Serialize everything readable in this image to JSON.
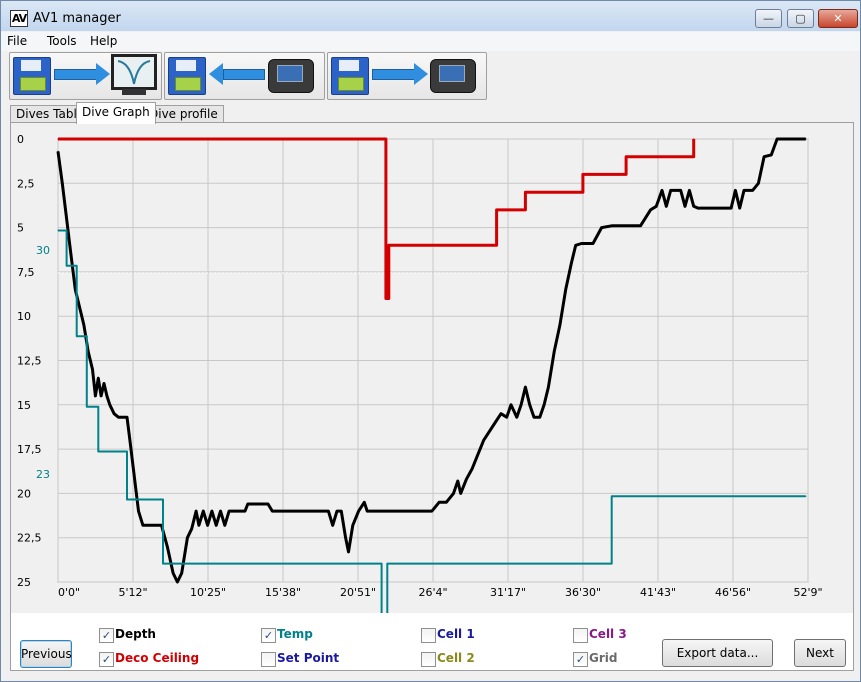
{
  "window": {
    "title": "AV1 manager",
    "icon_text": "AV",
    "minimize_icon": "minimize-icon",
    "maximize_icon": "maximize-icon",
    "close_icon": "close-icon"
  },
  "menu": {
    "items": [
      "File",
      "Tools",
      "Help"
    ]
  },
  "toolbar": {
    "buttons": [
      {
        "name": "save-to-monitor",
        "icons": [
          "floppy-disk-icon",
          "arrow-right-icon",
          "monitor-graph-icon"
        ]
      },
      {
        "name": "download-from-device",
        "icons": [
          "floppy-disk-icon",
          "arrow-left-icon",
          "dive-computer-icon"
        ]
      },
      {
        "name": "upload-to-device",
        "icons": [
          "floppy-disk-icon",
          "arrow-right-icon",
          "dive-computer-icon"
        ]
      }
    ]
  },
  "tabs": [
    {
      "label": "Dives Table",
      "active": false
    },
    {
      "label": "Dive Graph",
      "active": true
    },
    {
      "label": "Dive profile",
      "active": false
    }
  ],
  "chart_data": {
    "type": "line",
    "y_axis": {
      "reversed": true,
      "ylim": [
        0,
        25
      ],
      "tick_labels": [
        "0",
        "2,5",
        "5",
        "7,5",
        "10",
        "12,5",
        "15",
        "17,5",
        "20",
        "22,5",
        "25"
      ]
    },
    "x_axis": {
      "tick_labels": [
        "0'0\"",
        "5'12\"",
        "10'25\"",
        "15'38\"",
        "20'51\"",
        "26'4\"",
        "31'17\"",
        "36'30\"",
        "41'43\"",
        "46'56\"",
        "52'9\""
      ],
      "xlim_minutes": [
        0,
        52.15
      ]
    },
    "temp_axis": {
      "tick_labels": [
        "30",
        "23"
      ],
      "values": [
        30,
        23
      ]
    },
    "grid": true,
    "series": [
      {
        "name": "Depth",
        "color": "#000000",
        "axis": "depth_m",
        "points": [
          [
            0,
            0.7
          ],
          [
            0.3,
            2.5
          ],
          [
            0.6,
            4.5
          ],
          [
            0.9,
            6.5
          ],
          [
            1.2,
            8.5
          ],
          [
            1.5,
            9.5
          ],
          [
            1.8,
            10.5
          ],
          [
            2.1,
            12
          ],
          [
            2.4,
            13
          ],
          [
            2.6,
            14.5
          ],
          [
            2.8,
            13.5
          ],
          [
            3,
            14.5
          ],
          [
            3.2,
            13.8
          ],
          [
            3.4,
            14.5
          ],
          [
            3.6,
            15
          ],
          [
            3.9,
            15.5
          ],
          [
            4.2,
            15.7
          ],
          [
            4.8,
            15.7
          ],
          [
            5,
            17
          ],
          [
            5.3,
            19
          ],
          [
            5.6,
            21
          ],
          [
            5.9,
            21.8
          ],
          [
            6.5,
            21.8
          ],
          [
            7.2,
            21.8
          ],
          [
            7.6,
            23
          ],
          [
            8,
            24.5
          ],
          [
            8.3,
            25
          ],
          [
            8.6,
            24.5
          ],
          [
            9,
            22.5
          ],
          [
            9.3,
            22
          ],
          [
            9.6,
            21
          ],
          [
            9.8,
            21.8
          ],
          [
            10.1,
            21
          ],
          [
            10.4,
            21.8
          ],
          [
            10.7,
            21
          ],
          [
            11,
            21.8
          ],
          [
            11.3,
            21
          ],
          [
            11.6,
            21.8
          ],
          [
            11.9,
            21
          ],
          [
            12.3,
            21
          ],
          [
            13,
            21
          ],
          [
            13.2,
            20.6
          ],
          [
            14.6,
            20.6
          ],
          [
            14.9,
            21
          ],
          [
            16,
            21
          ],
          [
            17.5,
            21
          ],
          [
            18.8,
            21
          ],
          [
            19.1,
            21.8
          ],
          [
            19.4,
            21
          ],
          [
            19.7,
            21
          ],
          [
            20,
            22.5
          ],
          [
            20.2,
            23.3
          ],
          [
            20.5,
            21.8
          ],
          [
            20.9,
            21
          ],
          [
            21.3,
            20.5
          ],
          [
            21.5,
            21
          ],
          [
            22.5,
            21
          ],
          [
            24,
            21
          ],
          [
            26,
            21
          ],
          [
            26.5,
            20.5
          ],
          [
            27,
            20.5
          ],
          [
            27.5,
            20
          ],
          [
            27.8,
            19.3
          ],
          [
            28,
            20
          ],
          [
            28.4,
            19.2
          ],
          [
            28.8,
            18.6
          ],
          [
            29.2,
            17.8
          ],
          [
            29.6,
            17
          ],
          [
            30,
            16.5
          ],
          [
            30.4,
            16
          ],
          [
            30.8,
            15.5
          ],
          [
            31.2,
            15.7
          ],
          [
            31.5,
            15
          ],
          [
            31.9,
            15.7
          ],
          [
            32.2,
            15
          ],
          [
            32.5,
            14
          ],
          [
            32.8,
            15
          ],
          [
            33.1,
            15.7
          ],
          [
            33.5,
            15.7
          ],
          [
            33.8,
            15
          ],
          [
            34.1,
            14
          ],
          [
            34.5,
            12
          ],
          [
            34.9,
            10.5
          ],
          [
            35.3,
            8.5
          ],
          [
            35.7,
            7
          ],
          [
            36,
            6
          ],
          [
            36.4,
            5.9
          ],
          [
            37.2,
            5.9
          ],
          [
            37.8,
            5
          ],
          [
            38.5,
            4.9
          ],
          [
            40.5,
            4.9
          ],
          [
            41.2,
            4
          ],
          [
            41.6,
            3.8
          ],
          [
            42,
            2.9
          ],
          [
            42.3,
            3.8
          ],
          [
            42.6,
            2.9
          ],
          [
            43.3,
            2.9
          ],
          [
            43.6,
            3.8
          ],
          [
            43.9,
            2.9
          ],
          [
            44.2,
            3.8
          ],
          [
            44.5,
            3.9
          ],
          [
            46.8,
            3.9
          ],
          [
            47.1,
            2.9
          ],
          [
            47.4,
            3.9
          ],
          [
            47.7,
            2.9
          ],
          [
            48.3,
            2.9
          ],
          [
            48.7,
            2.5
          ],
          [
            49.1,
            1
          ],
          [
            49.6,
            0.9
          ],
          [
            50,
            0
          ],
          [
            52,
            0
          ]
        ]
      },
      {
        "name": "Deco Ceiling",
        "color": "#d20000",
        "axis": "depth_m",
        "points": [
          [
            0,
            0
          ],
          [
            22.8,
            0
          ],
          [
            22.8,
            9
          ],
          [
            23.0,
            9
          ],
          [
            23.0,
            6
          ],
          [
            30.5,
            6
          ],
          [
            30.5,
            4
          ],
          [
            32.5,
            4
          ],
          [
            32.5,
            3
          ],
          [
            36.5,
            3
          ],
          [
            36.5,
            2
          ],
          [
            39.5,
            2
          ],
          [
            39.5,
            1
          ],
          [
            44.2,
            1
          ],
          [
            44.2,
            0
          ]
        ]
      },
      {
        "name": "Temp",
        "color": "#00828a",
        "axis": "temp_c",
        "points": [
          [
            0,
            30.6
          ],
          [
            0.6,
            30.6
          ],
          [
            0.6,
            29.5
          ],
          [
            1.3,
            29.5
          ],
          [
            1.3,
            27.3
          ],
          [
            2,
            27.3
          ],
          [
            2,
            25.1
          ],
          [
            2.8,
            25.1
          ],
          [
            2.8,
            23.7
          ],
          [
            4.8,
            23.7
          ],
          [
            4.8,
            22.2
          ],
          [
            7.3,
            22.2
          ],
          [
            7.3,
            20.2
          ],
          [
            22.5,
            20.2
          ],
          [
            22.5,
            18.6
          ],
          [
            22.9,
            18.6
          ],
          [
            22.9,
            20.2
          ],
          [
            38.5,
            20.2
          ],
          [
            38.5,
            22.3
          ],
          [
            52,
            22.3
          ]
        ]
      }
    ]
  },
  "legend": {
    "items": [
      {
        "label": "Depth",
        "checked": true,
        "color": "#000000"
      },
      {
        "label": "Deco Ceiling",
        "checked": true,
        "color": "#d20000"
      },
      {
        "label": "Temp",
        "checked": true,
        "color": "#00828a"
      },
      {
        "label": "Set Point",
        "checked": false,
        "color": "#1a1aa0"
      },
      {
        "label": "Cell 1",
        "checked": false,
        "color": "#1a1aa0"
      },
      {
        "label": "Cell 2",
        "checked": false,
        "color": "#8a8a1a"
      },
      {
        "label": "Cell 3",
        "checked": false,
        "color": "#8a1a8a"
      },
      {
        "label": "Grid",
        "checked": true,
        "color": "#6a6a6a"
      }
    ]
  },
  "buttons": {
    "previous": "Previous",
    "export": "Export data...",
    "next": "Next"
  },
  "check_glyph": "✓"
}
